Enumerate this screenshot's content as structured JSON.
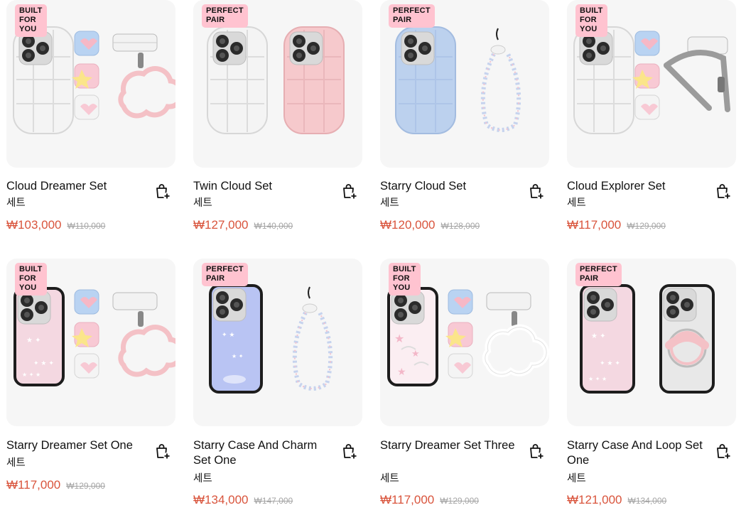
{
  "accent_color": "#d9543c",
  "badge_color": "#ffc3d0",
  "products": [
    {
      "badge": [
        "BUILT",
        "FOR",
        "YOU"
      ],
      "name": "Cloud Dreamer Set",
      "category": "세트",
      "price": "₩103,000",
      "original_price": "₩110,000",
      "icon": "cart-add-icon"
    },
    {
      "badge": [
        "PERFECT",
        "PAIR"
      ],
      "name": "Twin Cloud Set",
      "category": "세트",
      "price": "₩127,000",
      "original_price": "₩140,000",
      "icon": "cart-add-icon"
    },
    {
      "badge": [
        "PERFECT",
        "PAIR"
      ],
      "name": "Starry Cloud Set",
      "category": "세트",
      "price": "₩120,000",
      "original_price": "₩128,000",
      "icon": "cart-add-icon"
    },
    {
      "badge": [
        "BUILT",
        "FOR",
        "YOU"
      ],
      "name": "Cloud Explorer Set",
      "category": "세트",
      "price": "₩117,000",
      "original_price": "₩129,000",
      "icon": "cart-add-icon"
    },
    {
      "badge": [
        "BUILT",
        "FOR",
        "YOU"
      ],
      "name": "Starry Dreamer Set One",
      "category": "세트",
      "price": "₩117,000",
      "original_price": "₩129,000",
      "icon": "cart-add-icon"
    },
    {
      "badge": [
        "PERFECT",
        "PAIR"
      ],
      "name": "Starry Case And Charm Set One",
      "category": "세트",
      "price": "₩134,000",
      "original_price": "₩147,000",
      "icon": "cart-add-icon"
    },
    {
      "badge": [
        "BUILT",
        "FOR",
        "YOU"
      ],
      "name": "Starry Dreamer Set Three",
      "category": "세트",
      "price": "₩117,000",
      "original_price": "₩129,000",
      "icon": "cart-add-icon"
    },
    {
      "badge": [
        "PERFECT",
        "PAIR"
      ],
      "name": "Starry Case And Loop Set One",
      "category": "세트",
      "price": "₩121,000",
      "original_price": "₩134,000",
      "icon": "cart-add-icon"
    }
  ]
}
